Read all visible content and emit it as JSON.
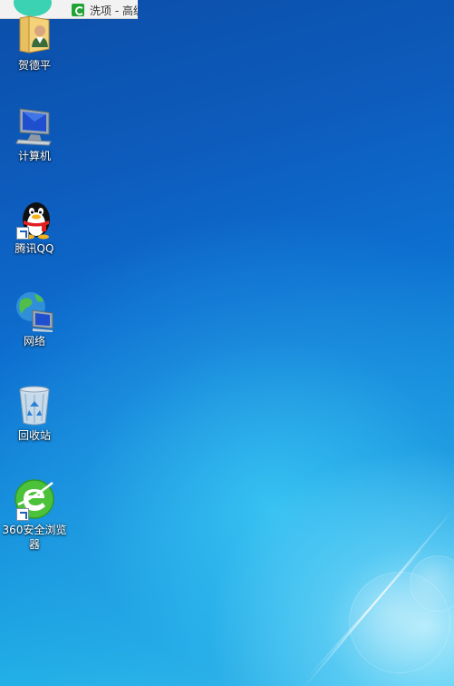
{
  "taskbar": {
    "window_title": "洗项 - 高级"
  },
  "desktop_icons": [
    {
      "label": "贺德平",
      "icon": "user-folder-icon"
    },
    {
      "label": "计算机",
      "icon": "computer-icon"
    },
    {
      "label": "腾讯QQ",
      "icon": "qq-penguin-icon"
    },
    {
      "label": "网络",
      "icon": "network-icon"
    },
    {
      "label": "回收站",
      "icon": "recycle-bin-icon"
    },
    {
      "label": "360安全浏览器",
      "icon": "360-browser-icon"
    }
  ],
  "colors": {
    "desktop_top": "#0b4ea8",
    "desktop_bottom": "#3cc8ee",
    "label_text": "#ffffff",
    "browser_green": "#4cc23a",
    "qq_red": "#e02020"
  }
}
